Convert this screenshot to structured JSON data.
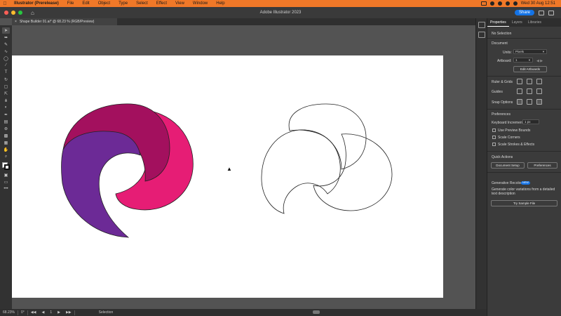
{
  "menubar": {
    "apple_icon": "apple-logo",
    "items": [
      "Illustrator (Prerelease)",
      "File",
      "Edit",
      "Object",
      "Type",
      "Select",
      "Effect",
      "View",
      "Window",
      "Help"
    ],
    "clock": "Wed 30 Aug  12:51"
  },
  "window": {
    "title": "Adobe Illustrator 2023",
    "share_label": "Share",
    "traffic_light_colors": [
      "#ff5f57",
      "#febc2e",
      "#28c840"
    ]
  },
  "document_tab": {
    "label": "Shape Builder 01.ai* @ 68.23 % (RGB/Preview)",
    "close_glyph": "×"
  },
  "toolbar": {
    "more_glyph": "•••"
  },
  "canvas": {
    "colors": {
      "magenta_dark": "#a3105e",
      "pink": "#e61d75",
      "purple": "#6c2a96",
      "outline": "#222222",
      "artboard": "#ffffff",
      "pasteboard": "#535353"
    }
  },
  "statusbar": {
    "zoom": "68.23%",
    "rotation": "0°",
    "artboard_num": "1",
    "tool_label": "Selection"
  },
  "panel": {
    "tabs": [
      "Properties",
      "Layers",
      "Libraries"
    ],
    "no_selection": "No Selection",
    "document_heading": "Document",
    "units_label": "Units:",
    "units_value": "Pixels",
    "artboard_label": "Artboard:",
    "artboard_value": "1",
    "edit_artboards": "Edit Artboards",
    "ruler_grids": "Ruler & Grids",
    "guides": "Guides",
    "snap_options": "Snap Options",
    "preferences_heading": "Preferences",
    "keyboard_increment_label": "Keyboard Increment:",
    "keyboard_increment_value": "1 px",
    "checkboxes": [
      "Use Preview Bounds",
      "Scale Corners",
      "Scale Strokes & Effects"
    ],
    "quick_actions": "Quick Actions",
    "document_setup": "Document Setup",
    "preferences_button": "Preferences",
    "generative_recolor": "Generative Recolor",
    "new_badge": "NEW",
    "generative_desc": "Generate color variations from a detailed text description",
    "try_sample": "Try Sample File"
  }
}
